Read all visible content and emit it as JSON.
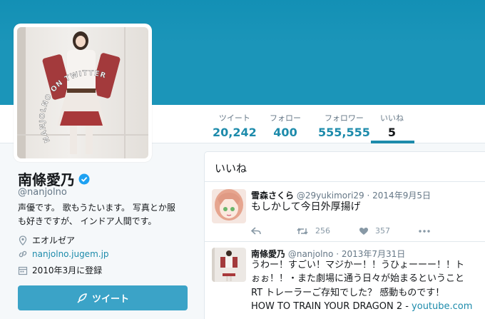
{
  "colors": {
    "accent": "#1d8bab",
    "banner": "#1b95b9",
    "button": "#3ba3c7"
  },
  "stats": [
    {
      "label": "ツイート",
      "value": "20,242"
    },
    {
      "label": "フォロー",
      "value": "400"
    },
    {
      "label": "フォロワー",
      "value": "555,555"
    },
    {
      "label": "いいね",
      "value": "5"
    }
  ],
  "avatar": {
    "watermark": "NANJOLNO ON TWITTER"
  },
  "profile": {
    "name": "南條愛乃",
    "handle": "@nanjolno",
    "bio_line1": "声優です。 歌もうたいます。 写真とか服",
    "bio_line2": "も好きですが、 インドア人間です。",
    "location": "エオルゼア",
    "url": "nanjolno.jugem.jp",
    "joined": "2010年3月に登録",
    "location_icon": "location-pin-icon",
    "url_icon": "link-icon",
    "joined_icon": "calendar-icon"
  },
  "tweet_button": {
    "label": "ツイート",
    "icon": "quill-icon"
  },
  "timeline": {
    "title": "いいね",
    "tweets": [
      {
        "name": "雪森さくら",
        "handle": "@29yukimori29",
        "date": "2014年9月5日",
        "text": "もしかして今日外厚揚げ",
        "retweets": "256",
        "likes": "357"
      },
      {
        "name": "南條愛乃",
        "handle": "@nanjolno",
        "date": "2013年7月31日",
        "line1": "うわー！すごい！マジかー！！うひょーーー！！ト",
        "line2": "ぉぉ！！・また劇場に通う日々が始まるということ",
        "line3": "RT トレーラーご存知でした？ 感動ものです！",
        "line4": "HOW TO TRAIN YOUR DRAGON 2 - ",
        "link": "youtube.com"
      }
    ]
  }
}
